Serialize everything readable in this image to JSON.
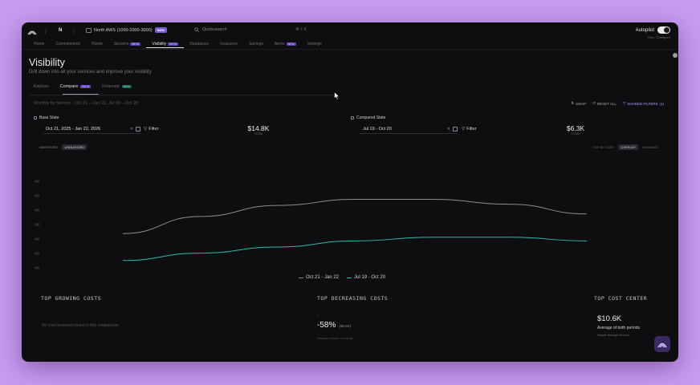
{
  "colors": {
    "accent": "#7b5cd6",
    "series_base": "#8a8a92",
    "series_compared": "#2fb8aa",
    "background": "#0e0e10"
  },
  "topbar": {
    "org": "N",
    "env_label": "North AWS (1000-2000-3000)",
    "env_badge": "NEW",
    "search_placeholder": "Quicksearch",
    "search_shortcut": "⌘ + K",
    "autopilot_label": "Autopilot",
    "autopilot_sub": "Pilot / Configure"
  },
  "nav": [
    {
      "label": "Home"
    },
    {
      "label": "Commitments"
    },
    {
      "label": "Fleets"
    },
    {
      "label": "Streams",
      "badge": "BETA"
    },
    {
      "label": "Visibility",
      "badge": "BETA",
      "active": true
    },
    {
      "label": "Databases"
    },
    {
      "label": "Insurance"
    },
    {
      "label": "Savings"
    },
    {
      "label": "Alerts",
      "badge": "NEW"
    },
    {
      "label": "Settings"
    }
  ],
  "page": {
    "title": "Visibility",
    "subtitle": "Drill down into all your services and improve your visibility"
  },
  "tabs": [
    {
      "label": "Explore"
    },
    {
      "label": "Compare",
      "tag": "BETA",
      "active": true
    },
    {
      "label": "Forecast",
      "tag": "NEW"
    }
  ],
  "crumb": "Monthly by Service · Oct 21 – Jan 22, Jul 19 – Oct 20",
  "actions": {
    "swap": "SWAP",
    "reset": "RESET ALL",
    "filters": "SHARED FILTERS",
    "filters_count": "(1)"
  },
  "base": {
    "label": "Base State",
    "range": "Oct 21, 2025 - Jan 22, 2026",
    "filter": "Filter",
    "total": "$14.8K",
    "total_label": "TOTAL"
  },
  "compared": {
    "label": "Compared State",
    "range": "Jul 19 - Oct 20",
    "filter": "Filter",
    "total": "$6.3K",
    "total_label": "TOTAL"
  },
  "pills_left": [
    {
      "label": "AMORTIZED"
    },
    {
      "label": "UNBLENDED",
      "on": true
    }
  ],
  "pills_right": [
    {
      "label": "TOP BY COST"
    },
    {
      "label": "OVERLAY",
      "on": true
    },
    {
      "label": "VARIANCE"
    }
  ],
  "chart_data": {
    "type": "line",
    "x": [
      1,
      2,
      3,
      4,
      5,
      6,
      7
    ],
    "series": [
      {
        "name": "Oct 21 - Jan 22",
        "values": [
          3.2,
          4.6,
          5.5,
          6.0,
          6.0,
          5.6,
          4.8
        ]
      },
      {
        "name": "Jul 19 - Oct 20",
        "values": [
          1.0,
          1.6,
          2.1,
          2.6,
          2.9,
          2.9,
          2.6
        ]
      }
    ],
    "ylim": [
      0,
      8
    ],
    "grid": true
  },
  "legend": [
    "Oct 21 - Jan 22",
    "Jul 19 - Oct 20"
  ],
  "cards": {
    "growing_title": "TOP GROWING COSTS",
    "growing_empty": "No cost increases found in this comparison",
    "decreasing_title": "TOP DECREASING COSTS",
    "decreasing_rank": "1",
    "decreasing_pct": "-58%",
    "decreasing_amount": "($8.6K)",
    "decreasing_service": "Amazon Elastic Compute",
    "center_title": "TOP COST CENTER",
    "center_value": "$10.6K",
    "center_sub": "Average of both periods",
    "center_item": "Simple Storage Service"
  }
}
